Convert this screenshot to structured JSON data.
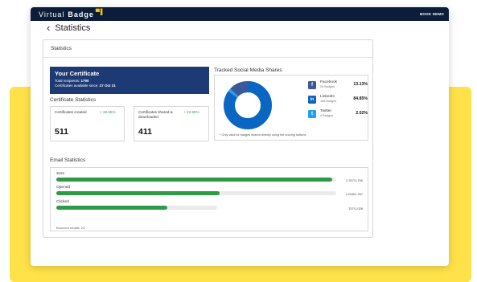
{
  "app": {
    "logo_light": "Virtual",
    "logo_bold": "Badge",
    "book_demo": "BOOK DEMO",
    "brand_color": "#0b1d3a",
    "accent_color": "#f5c800"
  },
  "header": {
    "back_icon": "chevron-left-icon",
    "title": "Statistics"
  },
  "card": {
    "title": "Statistics",
    "certificate": {
      "heading": "Your Certificate",
      "recipients_label": "Total recipients:",
      "recipients_value": "1790",
      "available_label": "Certificates available since:",
      "available_value": "27 Oct 21"
    },
    "certificate_stats": {
      "heading": "Certificate Statistics",
      "created": {
        "label": "Certificates created",
        "trend": "+ 29.55%",
        "value": "511"
      },
      "shared": {
        "label": "Certificates shared & downloaded",
        "trend": "+ 22.95%",
        "value": "411"
      }
    },
    "social": {
      "heading": "Tracked Social Media Shares",
      "items": [
        {
          "icon": "facebook-icon",
          "name": "Facebook",
          "sub": "26 Badges",
          "pct": "13.13%",
          "share": 13.13,
          "color": "#3b5998",
          "glyph": "f"
        },
        {
          "icon": "linkedin-icon",
          "name": "LinkedIn",
          "sub": "168 Badges",
          "pct": "84.85%",
          "share": 84.85,
          "color": "#0a66c2",
          "glyph": "in"
        },
        {
          "icon": "twitter-icon",
          "name": "Twitter",
          "sub": "4 Badges",
          "pct": "2.02%",
          "share": 2.02,
          "color": "#1da1f2",
          "glyph": "t"
        }
      ],
      "note": "* Only valid for badges shared directly using the sharing buttons"
    },
    "email": {
      "heading": "Email Statistics",
      "rows": [
        {
          "label": "Sent",
          "count": "1,767/1,790",
          "fraction": 0.987
        },
        {
          "label": "Opened",
          "count": "1,028/1,767",
          "fraction": 0.582
        },
        {
          "label": "Clicked",
          "count": "707/1,028",
          "fraction": 0.688
        }
      ],
      "bounced": "Bounced emails: 24",
      "bar_color": "#2f9a45"
    }
  }
}
